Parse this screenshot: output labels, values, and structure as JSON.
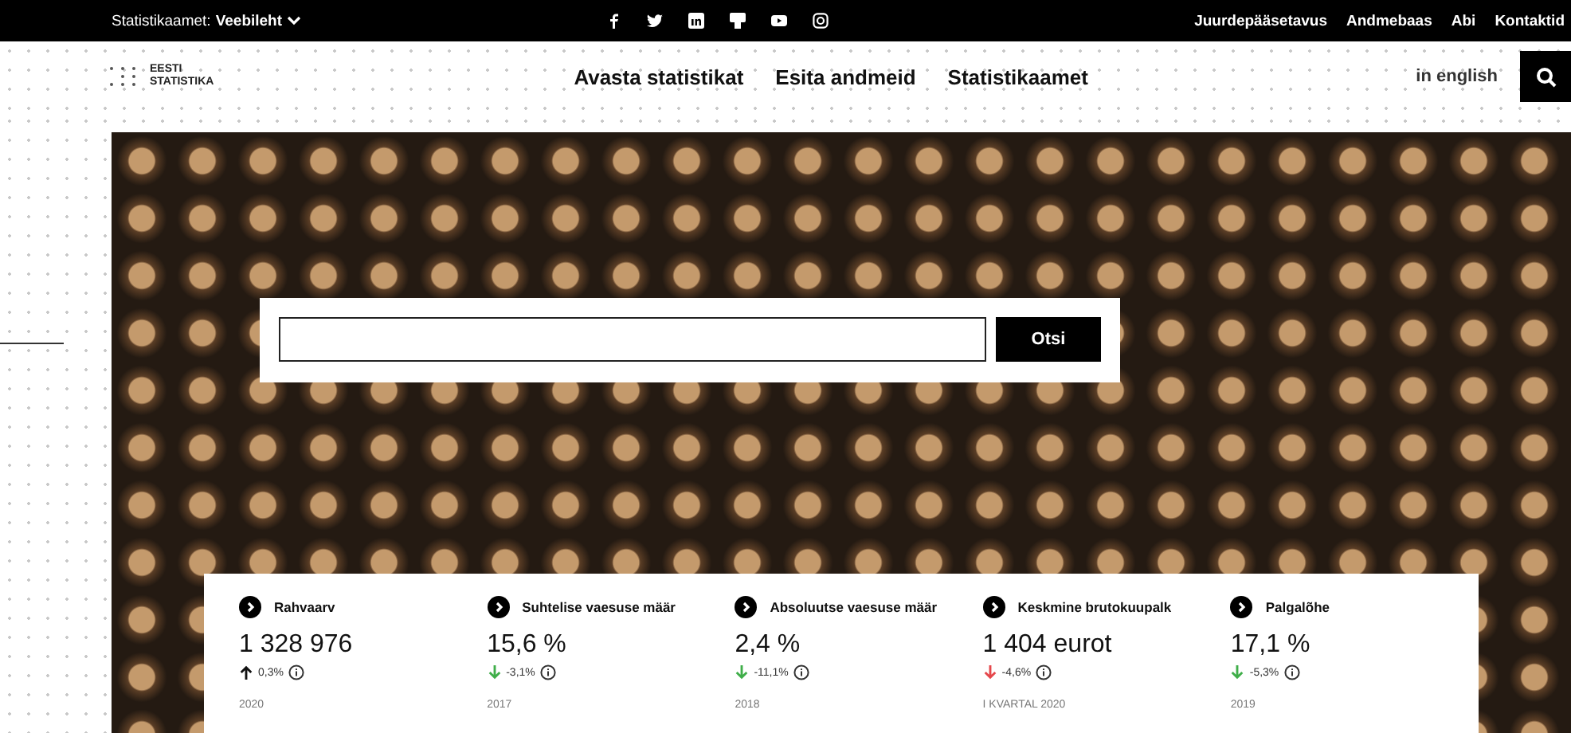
{
  "top_bar": {
    "site_label": "Statistikaamet:",
    "site_value": "Veebileht",
    "links": [
      "Juurdepääsetavus",
      "Andmebaas",
      "Abi",
      "Kontaktid"
    ]
  },
  "header": {
    "logo_lines": [
      "EESTI",
      "STATISTIKA"
    ],
    "nav": [
      "Avasta statistikat",
      "Esita andmeid",
      "Statistikaamet"
    ],
    "language": "in english"
  },
  "search": {
    "button": "Otsi"
  },
  "stats": [
    {
      "title": "Rahvaarv",
      "value": "1 328 976",
      "change": "0,3%",
      "kind": "up",
      "color": "#111111",
      "period": "2020"
    },
    {
      "title": "Suhtelise vaesuse määr",
      "value": "15,6 %",
      "change": "-3,1%",
      "kind": "down",
      "color": "#3fae49",
      "period": "2017"
    },
    {
      "title": "Absoluutse vaesuse määr",
      "value": "2,4 %",
      "change": "-11,1%",
      "kind": "down",
      "color": "#3fae49",
      "period": "2018"
    },
    {
      "title": "Keskmine brutokuupalk",
      "value": "1 404 eurot",
      "change": "-4,6%",
      "kind": "down",
      "color": "#e5474b",
      "period": "I KVARTAL 2020"
    },
    {
      "title": "Palgalõhe",
      "value": "17,1 %",
      "change": "-5,3%",
      "kind": "down",
      "color": "#3fae49",
      "period": "2019"
    }
  ]
}
